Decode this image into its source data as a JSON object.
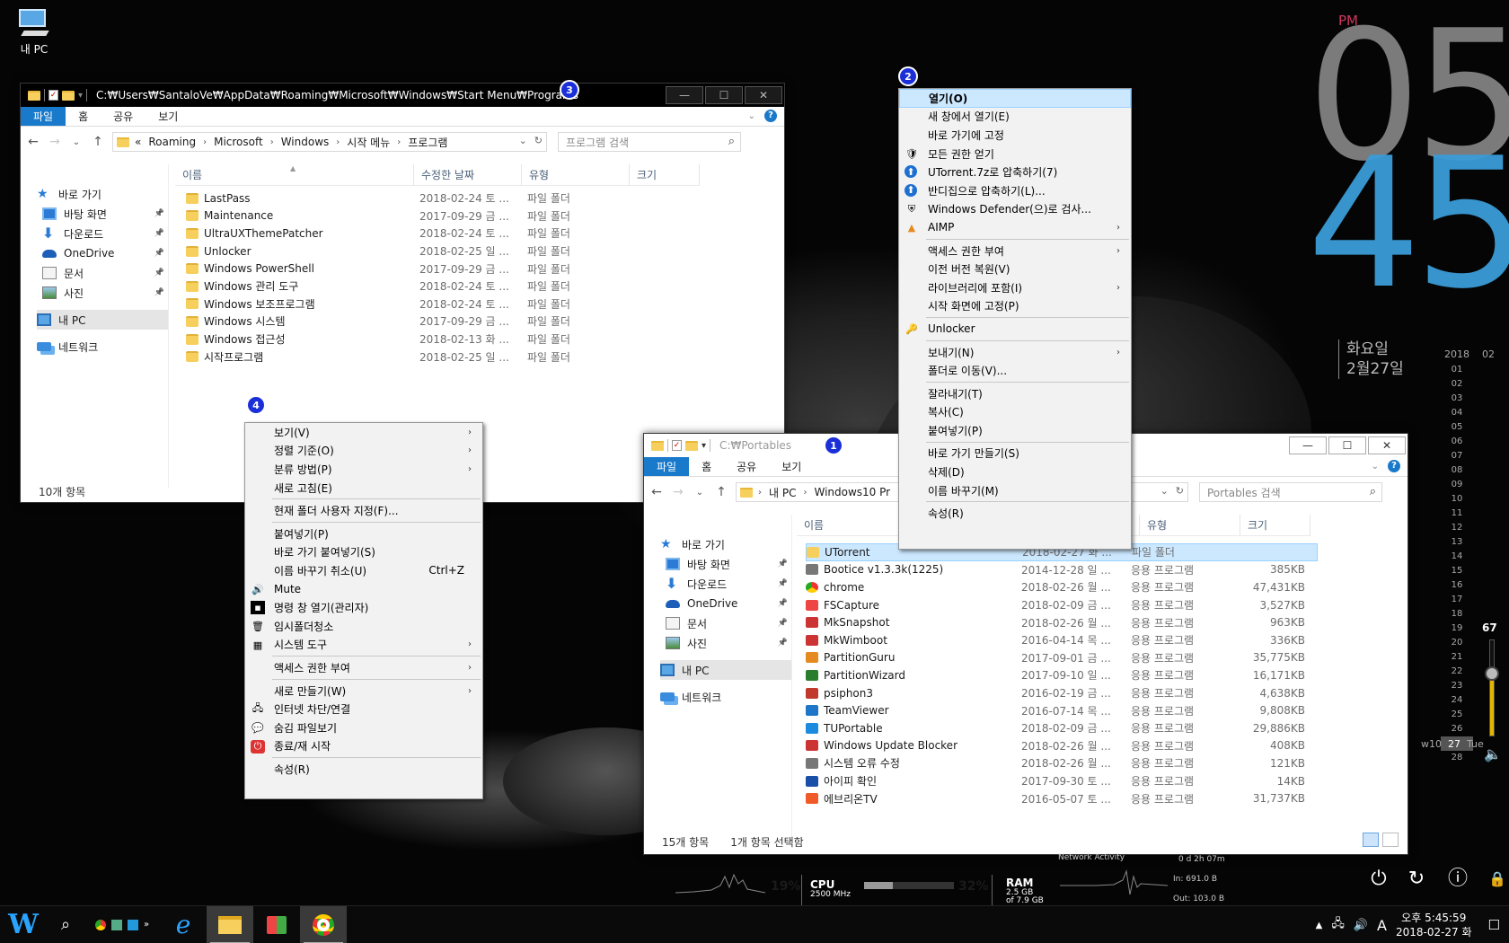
{
  "desktop": {
    "icon_label": "내 PC"
  },
  "window_programs": {
    "title": "C:₩Users₩SantaloVe₩AppData₩Roaming₩Microsoft₩Windows₩Start Menu₩Programs",
    "badge": "3",
    "ribbon_tabs": [
      "파일",
      "홈",
      "공유",
      "보기"
    ],
    "breadcrumb": [
      "«",
      "Roaming",
      "Microsoft",
      "Windows",
      "시작 메뉴",
      "프로그램"
    ],
    "search_placeholder": "프로그램 검색",
    "nav": [
      "바로 가기",
      "바탕 화면",
      "다운로드",
      "OneDrive",
      "문서",
      "사진",
      "내 PC",
      "네트워크"
    ],
    "columns": [
      "이름",
      "수정한 날짜",
      "유형",
      "크기"
    ],
    "rows": [
      {
        "name": "LastPass",
        "date": "2018-02-24 토 ...",
        "type": "파일 폴더"
      },
      {
        "name": "Maintenance",
        "date": "2017-09-29 금 ...",
        "type": "파일 폴더"
      },
      {
        "name": "UltraUXThemePatcher",
        "date": "2018-02-24 토 ...",
        "type": "파일 폴더"
      },
      {
        "name": "Unlocker",
        "date": "2018-02-25 일 ...",
        "type": "파일 폴더"
      },
      {
        "name": "Windows PowerShell",
        "date": "2017-09-29 금 ...",
        "type": "파일 폴더"
      },
      {
        "name": "Windows 관리 도구",
        "date": "2018-02-24 토 ...",
        "type": "파일 폴더"
      },
      {
        "name": "Windows 보조프로그램",
        "date": "2018-02-24 토 ...",
        "type": "파일 폴더"
      },
      {
        "name": "Windows 시스템",
        "date": "2017-09-29 금 ...",
        "type": "파일 폴더"
      },
      {
        "name": "Windows 접근성",
        "date": "2018-02-13 화 ...",
        "type": "파일 폴더"
      },
      {
        "name": "시작프로그램",
        "date": "2018-02-25 일 ...",
        "type": "파일 폴더"
      }
    ],
    "status": "10개 항목"
  },
  "window_portables": {
    "title": "C:₩Portables",
    "badge": "1",
    "ribbon_tabs": [
      "파일",
      "홈",
      "공유",
      "보기"
    ],
    "breadcrumb": [
      "내 PC",
      "Windows10 Pr"
    ],
    "search_placeholder": "Portables 검색",
    "nav": [
      "바로 가기",
      "바탕 화면",
      "다운로드",
      "OneDrive",
      "문서",
      "사진",
      "내 PC",
      "네트워크"
    ],
    "columns": [
      "이름",
      "유형",
      "크기"
    ],
    "rows": [
      {
        "name": "UTorrent",
        "date": "2018-02-27 화 ...",
        "type": "파일 폴더",
        "size": "",
        "icon": "folder"
      },
      {
        "name": "Bootice v1.3.3k(1225)",
        "date": "2014-12-28 일 ...",
        "type": "응용 프로그램",
        "size": "385KB",
        "icon": "gear"
      },
      {
        "name": "chrome",
        "date": "2018-02-26 월 ...",
        "type": "응용 프로그램",
        "size": "47,431KB",
        "icon": "chrome"
      },
      {
        "name": "FSCapture",
        "date": "2018-02-09 금 ...",
        "type": "응용 프로그램",
        "size": "3,527KB",
        "icon": "fscapture"
      },
      {
        "name": "MkSnapshot",
        "date": "2018-02-26 월 ...",
        "type": "응용 프로그램",
        "size": "963KB",
        "icon": "mk"
      },
      {
        "name": "MkWimboot",
        "date": "2016-04-14 목 ...",
        "type": "응용 프로그램",
        "size": "336KB",
        "icon": "mk"
      },
      {
        "name": "PartitionGuru",
        "date": "2017-09-01 금 ...",
        "type": "응용 프로그램",
        "size": "35,775KB",
        "icon": "pguru"
      },
      {
        "name": "PartitionWizard",
        "date": "2017-09-10 일 ...",
        "type": "응용 프로그램",
        "size": "16,171KB",
        "icon": "pwiz"
      },
      {
        "name": "psiphon3",
        "date": "2016-02-19 금 ...",
        "type": "응용 프로그램",
        "size": "4,638KB",
        "icon": "psiphon"
      },
      {
        "name": "TeamViewer",
        "date": "2016-07-14 목 ...",
        "type": "응용 프로그램",
        "size": "9,808KB",
        "icon": "tv"
      },
      {
        "name": "TUPortable",
        "date": "2018-02-09 금 ...",
        "type": "응용 프로그램",
        "size": "29,886KB",
        "icon": "tu"
      },
      {
        "name": "Windows Update Blocker",
        "date": "2018-02-26 월 ...",
        "type": "응용 프로그램",
        "size": "408KB",
        "icon": "wub"
      },
      {
        "name": "시스템 오류 수정",
        "date": "2018-02-26 월 ...",
        "type": "응용 프로그램",
        "size": "121KB",
        "icon": "gear"
      },
      {
        "name": "아이피 확인",
        "date": "2017-09-30 토 ...",
        "type": "응용 프로그램",
        "size": "14KB",
        "icon": "ip"
      },
      {
        "name": "에브리온TV",
        "date": "2016-05-07 토 ...",
        "type": "응용 프로그램",
        "size": "31,737KB",
        "icon": "evtv"
      }
    ],
    "status_count": "15개 항목",
    "status_selected": "1개 항목 선택함"
  },
  "context_menu_folder": {
    "badge": "2",
    "items": [
      "열기(O)",
      "새 창에서 열기(E)",
      "바로 가기에 고정",
      "모든 권한 얻기",
      "UTorrent.7z로 압축하기(7)",
      "반디집으로 압축하기(L)...",
      "Windows Defender(으)로 검사...",
      "AIMP",
      "액세스 권한 부여",
      "이전 버전 복원(V)",
      "라이브러리에 포함(I)",
      "시작 화면에 고정(P)",
      "Unlocker",
      "보내기(N)",
      "폴더로 이동(V)...",
      "잘라내기(T)",
      "복사(C)",
      "붙여넣기(P)",
      "바로 가기 만들기(S)",
      "삭제(D)",
      "이름 바꾸기(M)",
      "속성(R)"
    ]
  },
  "context_menu_background": {
    "badge": "4",
    "items": [
      "보기(V)",
      "정렬 기준(O)",
      "분류 방법(P)",
      "새로 고침(E)",
      "현재 폴더 사용자 지정(F)...",
      "붙여넣기(P)",
      "바로 가기 붙여넣기(S)",
      "이름 바꾸기 취소(U)",
      "Mute",
      "명령 창 열기(관리자)",
      "임시폴더청소",
      "시스템 도구",
      "액세스 권한 부여",
      "새로 만들기(W)",
      "인터넷 차단/연결",
      "숨김 파일보기",
      "종료/재 시작",
      "속성(R)"
    ],
    "undo_shortcut": "Ctrl+Z"
  },
  "clock": {
    "ampm": "PM",
    "hour": "05",
    "minute": "45",
    "weekday": "화요일",
    "date": "2월27일"
  },
  "calendar": {
    "year": "2018",
    "month": "02",
    "days": [
      "01",
      "02",
      "03",
      "04",
      "05",
      "06",
      "07",
      "08",
      "09",
      "10",
      "11",
      "12",
      "13",
      "14",
      "15",
      "16",
      "17",
      "18",
      "19",
      "20",
      "21",
      "22",
      "23",
      "24",
      "25",
      "26",
      "27",
      "28"
    ],
    "today": "27",
    "week_label": "w10",
    "day_num": "27",
    "day_name": "Tue"
  },
  "volume": {
    "value": "67",
    "level": 0.67
  },
  "sysmon": {
    "cpu_pct": "19%",
    "cpu_label": "CPU",
    "cpu_freq": "2500 MHz",
    "ram_pct": "32%",
    "ram_label": "RAM",
    "ram_used": "2.5 GB",
    "ram_total": "of 7.9 GB",
    "net_title": "Network Activity",
    "uptime": "0 d 2h 07m",
    "net_in": "In: 691.0 B",
    "net_out": "Out: 103.0 B"
  },
  "taskbar": {
    "ime": "A",
    "time": "오후 5:45:59",
    "date": "2018-02-27 화"
  }
}
